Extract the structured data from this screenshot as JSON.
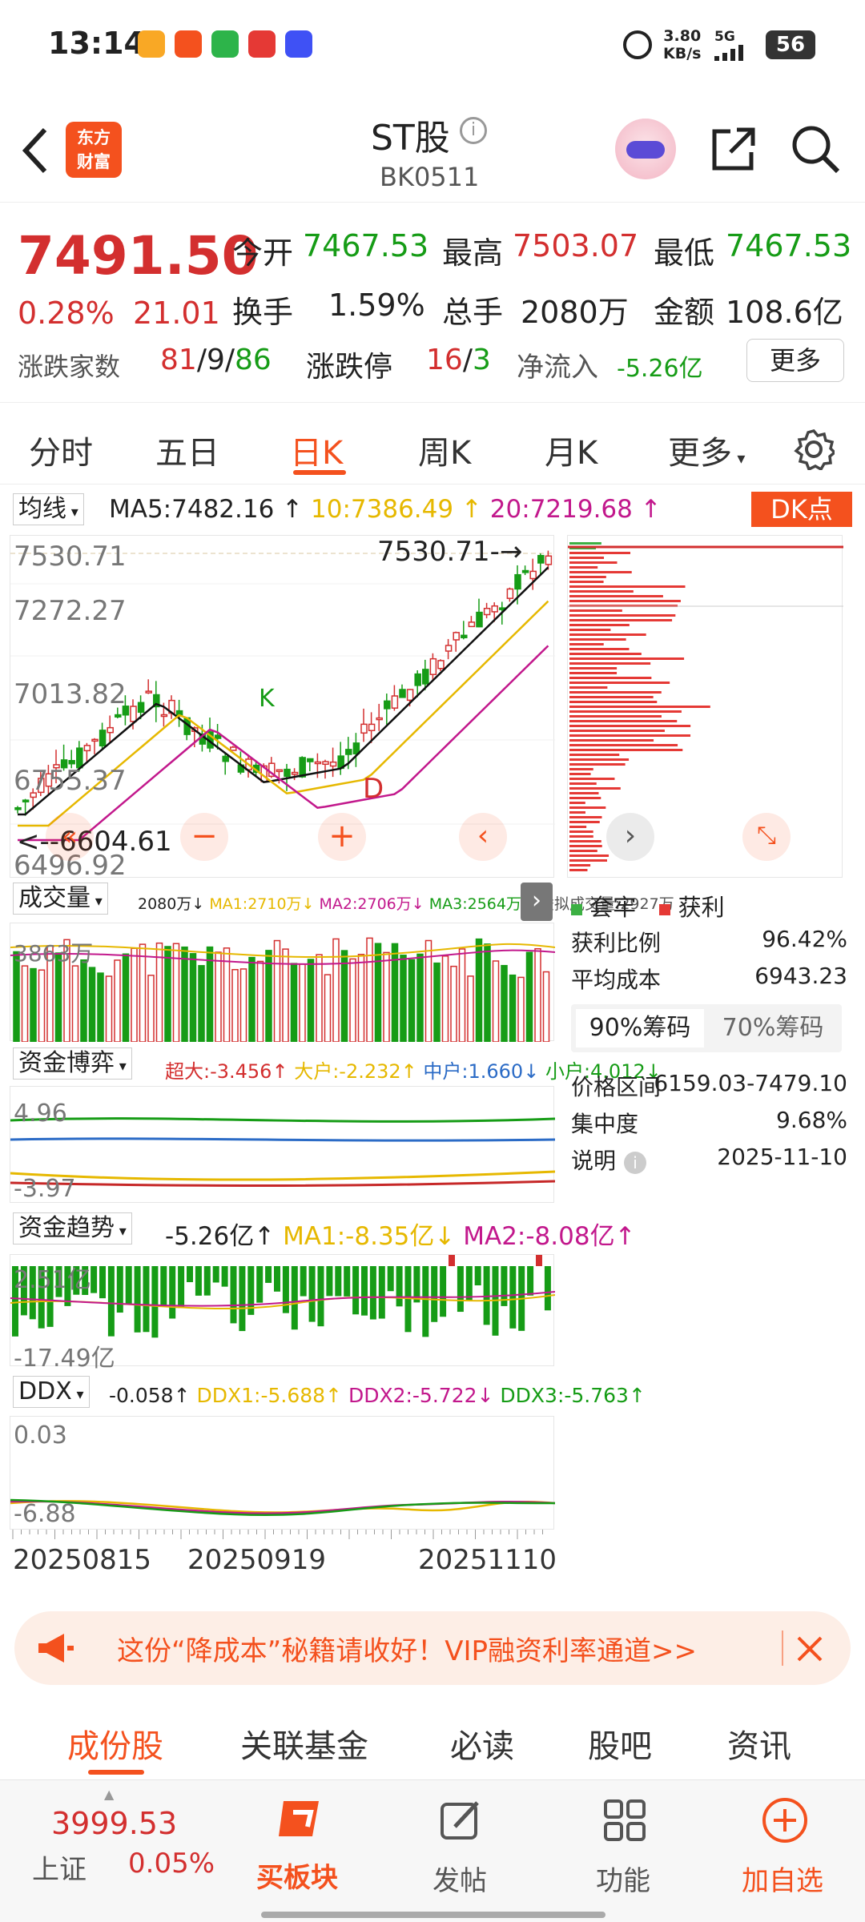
{
  "status": {
    "time": "13:14",
    "speed": "3.80",
    "speed_unit": "KB/s",
    "net": "5G",
    "battery": "56"
  },
  "header": {
    "logo_line1": "东方",
    "logo_line2": "财富",
    "title": "ST股",
    "code": "BK0511"
  },
  "quote": {
    "price": "7491.50",
    "pct": "0.28%",
    "change": "21.01",
    "open_label": "今开",
    "open": "7467.53",
    "high_label": "最高",
    "high": "7503.07",
    "low_label": "最低",
    "low": "7467.53",
    "turnover_label": "换手",
    "turnover": "1.59%",
    "vol_label": "总手",
    "vol": "2080万",
    "amount_label": "金额",
    "amount": "108.6亿",
    "updown_label": "涨跌家数",
    "up": "81",
    "flat": "9",
    "down": "86",
    "limit_label": "涨跌停",
    "limit_up": "16",
    "limit_down": "3",
    "netflow_label": "净流入",
    "netflow": "-5.26亿",
    "more": "更多"
  },
  "tabs": {
    "t1": "分时",
    "t2": "五日",
    "t3": "日K",
    "t4": "周K",
    "t5": "月K",
    "t6": "更多"
  },
  "ma": {
    "selector": "均线",
    "ma5": "MA5:7482.16",
    "ma10": "10:7386.49",
    "ma20": "20:7219.68",
    "dk": "DK点"
  },
  "kline": {
    "y1": "7530.71",
    "y2": "7272.27",
    "y3": "7013.82",
    "y4": "6755.37",
    "y5": "6496.92",
    "hi_label": "7530.71",
    "lo_label": "6604.61",
    "mark_k": "K",
    "mark_d": "D"
  },
  "volume": {
    "selector": "成交量",
    "v": "2080万",
    "ma1": "MA1:2710万",
    "ma2": "MA2:2706万",
    "ma3": "MA3:2564万",
    "virt": "虚拟成交量:2927万",
    "axis": "3863万"
  },
  "fund_game": {
    "selector": "资金博弈",
    "super": "超大:-3.456",
    "big": "大户:-2.232",
    "mid": "中户:1.660",
    "small": "小户:4.012",
    "top": "4.96",
    "bottom": "-3.97"
  },
  "fund_trend": {
    "selector": "资金趋势",
    "v": "-5.26亿",
    "ma1": "MA1:-8.35亿",
    "ma2": "MA2:-8.08亿",
    "top": "2.51亿",
    "bottom": "-17.49亿"
  },
  "ddx": {
    "selector": "DDX",
    "v": "-0.058",
    "ddx1": "DDX1:-5.688",
    "ddx2": "DDX2:-5.722",
    "ddx3": "DDX3:-5.763",
    "top": "0.03",
    "bottom": "-6.88"
  },
  "dates": {
    "d1": "20250815",
    "d2": "20250919",
    "d3": "20251110"
  },
  "chips": {
    "legend_trap": "套牢",
    "legend_profit": "获利",
    "profit_ratio_label": "获利比例",
    "profit_ratio": "96.42%",
    "avg_cost_label": "平均成本",
    "avg_cost": "6943.23",
    "tab90": "90%筹码",
    "tab70": "70%筹码",
    "range_label": "价格区间",
    "range": "6159.03-7479.10",
    "conc_label": "集中度",
    "conc": "9.68%",
    "desc_label": "说明",
    "desc": "2025-11-10"
  },
  "banner": {
    "text": "这份“降成本”秘籍请收好！VIP融资利率通道>>"
  },
  "subtabs": {
    "s1": "成份股",
    "s2": "关联基金",
    "s3": "必读",
    "s4": "股吧",
    "s5": "资讯"
  },
  "bottom": {
    "index_val": "3999.53",
    "index_name": "上证",
    "index_pct": "0.05%",
    "buy": "买板块",
    "post": "发帖",
    "func": "功能",
    "fav": "加自选"
  },
  "colors": {
    "red": "#d32f2f",
    "green": "#169c16",
    "orange": "#f4511e",
    "yellow": "#e6b800",
    "purple": "#c2188c"
  }
}
